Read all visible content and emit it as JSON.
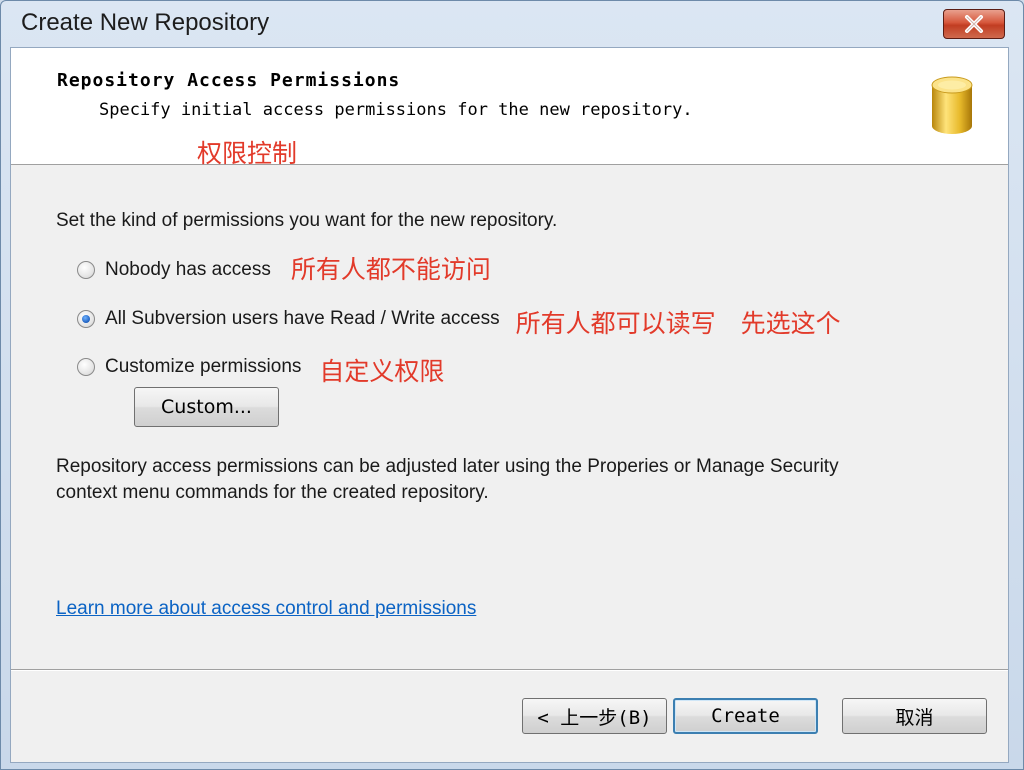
{
  "window": {
    "title": "Create New Repository"
  },
  "header": {
    "title": "Repository Access Permissions",
    "subtitle": "Specify initial access permissions for the new repository.",
    "annotation": "权限控制"
  },
  "body": {
    "prompt": "Set the kind of permissions you want for the new repository.",
    "options": [
      {
        "label": "Nobody has access",
        "checked": false,
        "annotation": "所有人都不能访问"
      },
      {
        "label": "All Subversion users have Read / Write access",
        "checked": true,
        "annotation": "所有人都可以读写　先选这个"
      },
      {
        "label": "Customize permissions",
        "checked": false,
        "annotation": "自定义权限"
      }
    ],
    "custom_button": "Custom...",
    "info_line1": "Repository access permissions can be adjusted later using the Properies or Manage Security",
    "info_line2": "context menu commands for the created repository.",
    "link": "Learn more about access control and permissions"
  },
  "footer": {
    "back_button": "< 上一步(B)",
    "create_button": "Create",
    "cancel_button": "取消"
  },
  "colors": {
    "annotation": "#e23a2a",
    "link": "#0b63c4",
    "close_button": "#c13d22"
  },
  "icons": {
    "close": "close-icon",
    "database": "database-icon"
  }
}
